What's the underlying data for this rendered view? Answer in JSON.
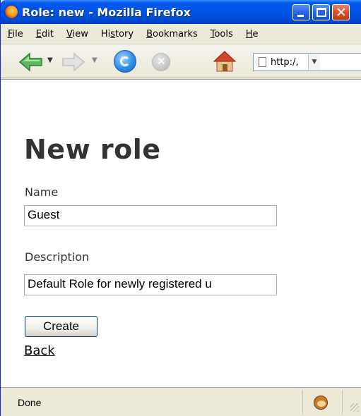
{
  "window": {
    "title": "Role: new - Mozilla Firefox"
  },
  "menubar": {
    "items": [
      {
        "mnemonic": "F",
        "rest": "ile"
      },
      {
        "mnemonic": "E",
        "rest": "dit"
      },
      {
        "mnemonic": "V",
        "rest": "iew"
      },
      {
        "pre": "Hi",
        "mnemonic": "s",
        "rest": "tory"
      },
      {
        "mnemonic": "B",
        "rest": "ookmarks"
      },
      {
        "mnemonic": "T",
        "rest": "ools"
      },
      {
        "mnemonic": "H",
        "rest": "e"
      }
    ]
  },
  "navbar": {
    "url_text": "http:/,",
    "icons": [
      "back-icon",
      "forward-icon",
      "reload-icon",
      "stop-icon",
      "home-icon",
      "page-icon"
    ]
  },
  "page": {
    "title": "New role",
    "name_label": "Name",
    "name_value": "Guest",
    "description_label": "Description",
    "description_value": "Default Role for newly registered u",
    "create_label": "Create",
    "back_label": "Back"
  },
  "statusbar": {
    "text": "Done"
  },
  "colors": {
    "titlebar": "#0054e3",
    "chrome": "#ece9d8",
    "heading": "#333333"
  }
}
